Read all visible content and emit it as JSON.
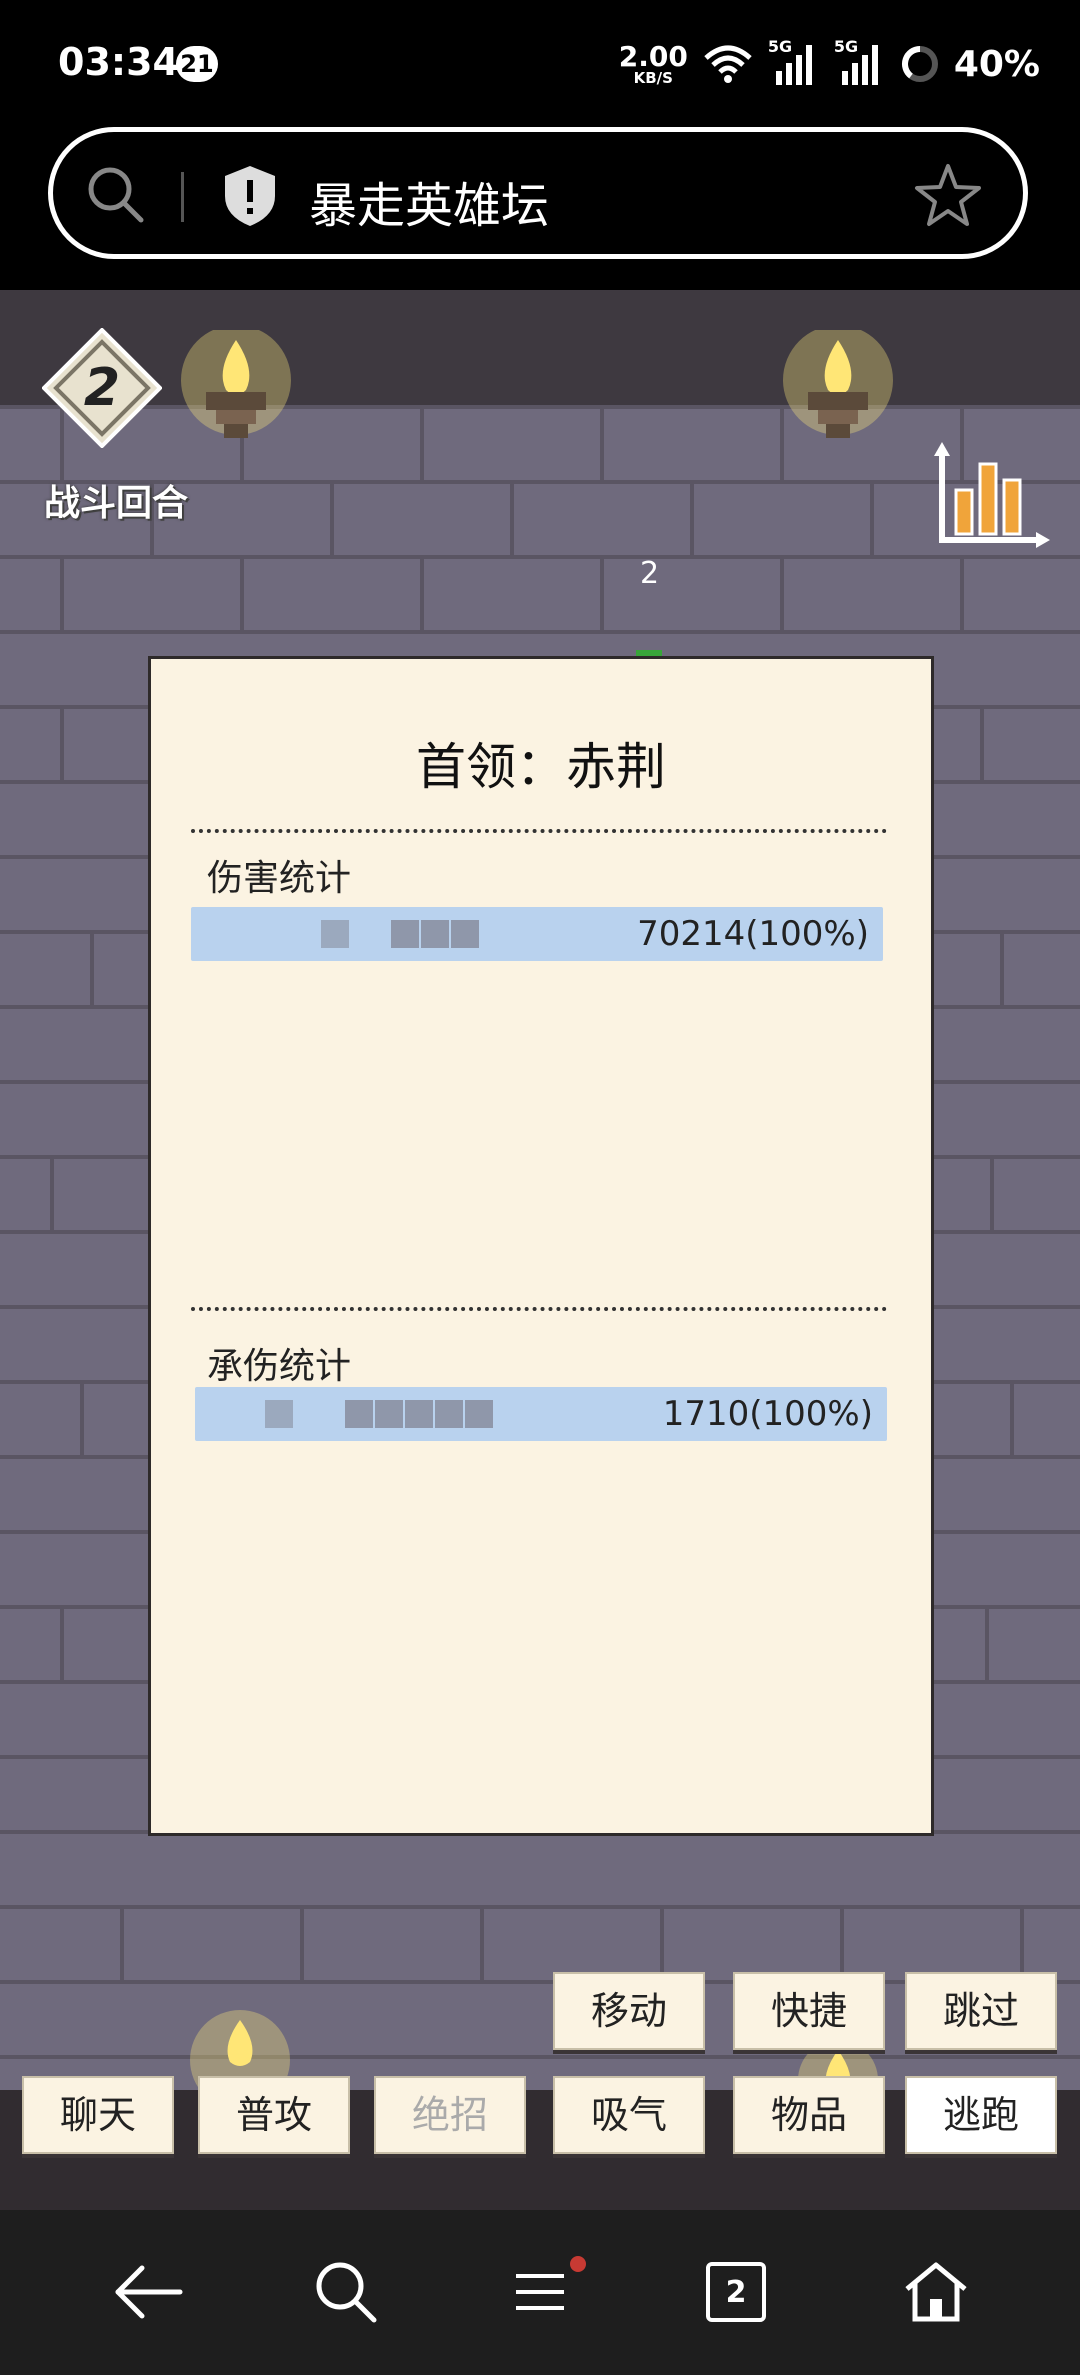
{
  "status_bar": {
    "time": "03:34",
    "notification_count": "21",
    "net_speed_value": "2.00",
    "net_speed_unit": "KB/S",
    "signal_1_label": "5G",
    "signal_2_label": "5G",
    "battery": "40%"
  },
  "browser": {
    "url_title": "暴走英雄坛",
    "icons": [
      "search-icon",
      "shield-icon",
      "star-icon"
    ]
  },
  "game": {
    "round_number": "2",
    "round_label": "战斗回合",
    "floating_number": "2",
    "panel": {
      "title": "首领：赤荆",
      "damage_section": {
        "label": "伤害统计",
        "value": "70214(100%)",
        "share": 1.0
      },
      "taken_section": {
        "label": "承伤统计",
        "value": "1710(100%)",
        "share": 1.0
      }
    },
    "buttons_top": [
      "移动",
      "快捷",
      "跳过"
    ],
    "buttons_bottom": [
      "聊天",
      "普攻",
      "绝招",
      "吸气",
      "物品",
      "逃跑"
    ]
  },
  "nav": {
    "tab_count": "2",
    "icons": [
      "back-icon",
      "search-icon",
      "menu-icon",
      "tabs-icon",
      "home-icon"
    ],
    "menu_dot_color": "#c73a33"
  }
}
